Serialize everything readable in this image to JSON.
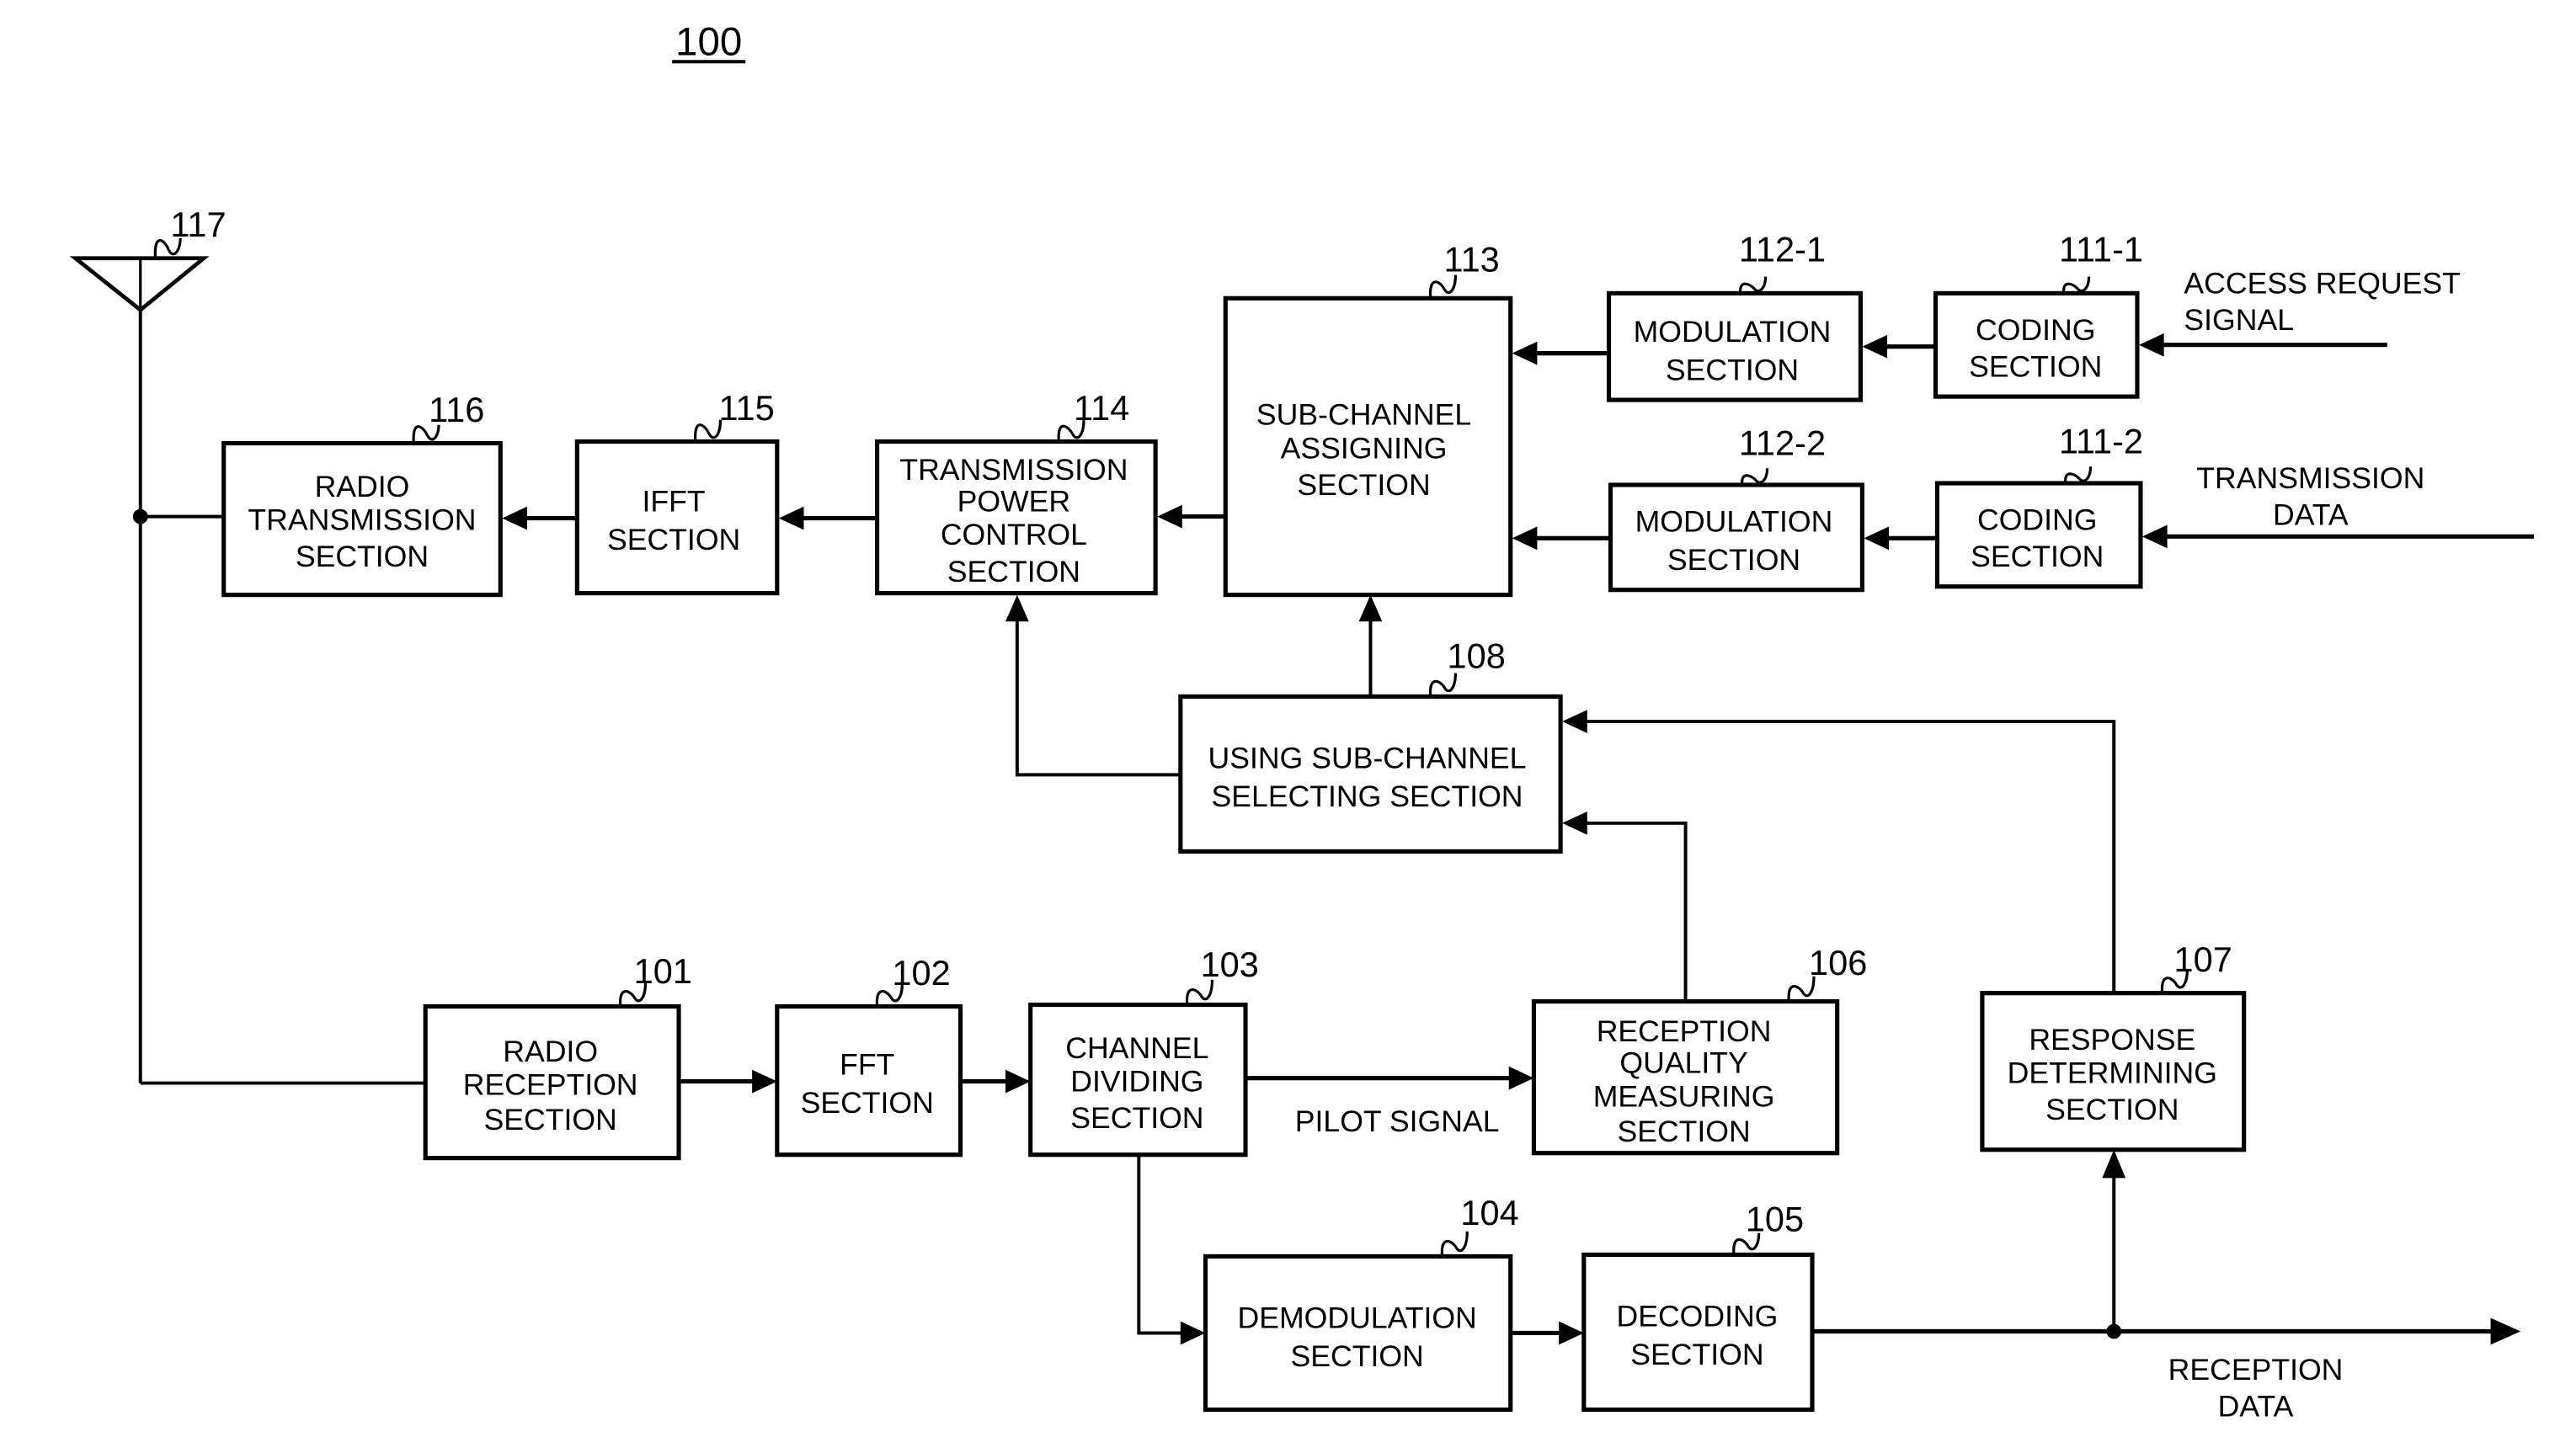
{
  "figure": {
    "title": "100"
  },
  "antenna": {
    "ref": "117",
    "icon": "antenna-icon"
  },
  "blocks": {
    "radio_transmission": {
      "ref": "116",
      "lines": [
        "RADIO",
        "TRANSMISSION",
        "SECTION"
      ]
    },
    "ifft": {
      "ref": "115",
      "lines": [
        "IFFT",
        "SECTION"
      ]
    },
    "transmission_power_control": {
      "ref": "114",
      "lines": [
        "TRANSMISSION",
        "POWER",
        "CONTROL",
        "SECTION"
      ]
    },
    "sub_channel_assigning": {
      "ref": "113",
      "lines": [
        "SUB-CHANNEL",
        "ASSIGNING",
        "SECTION"
      ]
    },
    "modulation_1": {
      "ref": "112-1",
      "lines": [
        "MODULATION",
        "SECTION"
      ]
    },
    "coding_1": {
      "ref": "111-1",
      "lines": [
        "CODING",
        "SECTION"
      ]
    },
    "modulation_2": {
      "ref": "112-2",
      "lines": [
        "MODULATION",
        "SECTION"
      ]
    },
    "coding_2": {
      "ref": "111-2",
      "lines": [
        "CODING",
        "SECTION"
      ]
    },
    "using_sub_channel_selecting": {
      "ref": "108",
      "lines": [
        "USING SUB-CHANNEL",
        "SELECTING SECTION"
      ]
    },
    "radio_reception": {
      "ref": "101",
      "lines": [
        "RADIO",
        "RECEPTION",
        "SECTION"
      ]
    },
    "fft": {
      "ref": "102",
      "lines": [
        "FFT",
        "SECTION"
      ]
    },
    "channel_dividing": {
      "ref": "103",
      "lines": [
        "CHANNEL",
        "DIVIDING",
        "SECTION"
      ]
    },
    "reception_quality_measuring": {
      "ref": "106",
      "lines": [
        "RECEPTION",
        "QUALITY",
        "MEASURING",
        "SECTION"
      ]
    },
    "response_determining": {
      "ref": "107",
      "lines": [
        "RESPONSE",
        "DETERMINING",
        "SECTION"
      ]
    },
    "demodulation": {
      "ref": "104",
      "lines": [
        "DEMODULATION",
        "SECTION"
      ]
    },
    "decoding": {
      "ref": "105",
      "lines": [
        "DECODING",
        "SECTION"
      ]
    }
  },
  "signals": {
    "access_request": [
      "ACCESS REQUEST",
      "SIGNAL"
    ],
    "transmission_data": [
      "TRANSMISSION",
      "DATA"
    ],
    "pilot_signal": "PILOT SIGNAL",
    "reception_data": [
      "RECEPTION",
      "DATA"
    ]
  }
}
